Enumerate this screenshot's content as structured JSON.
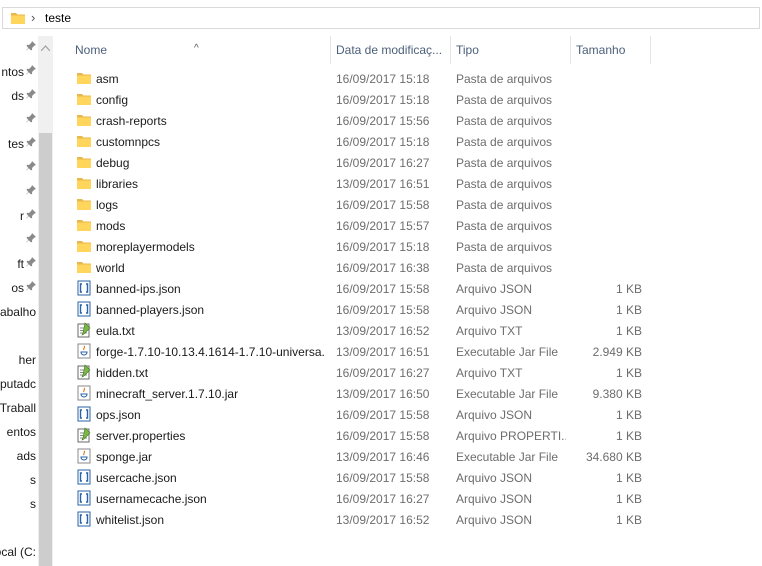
{
  "address": {
    "path": "teste"
  },
  "columns": {
    "name": "Nome",
    "date": "Data de modificaç...",
    "type": "Tipo",
    "size": "Tamanho"
  },
  "nav_items": [
    {
      "label": "",
      "pinned": true
    },
    {
      "label": "ntos",
      "pinned": true
    },
    {
      "label": "ds",
      "pinned": true
    },
    {
      "label": "",
      "pinned": true
    },
    {
      "label": "tes",
      "pinned": true
    },
    {
      "label": "",
      "pinned": true
    },
    {
      "label": "",
      "pinned": true
    },
    {
      "label": "r",
      "pinned": true
    },
    {
      "label": "",
      "pinned": true
    },
    {
      "label": "ft",
      "pinned": true
    },
    {
      "label": "os",
      "pinned": true
    },
    {
      "label": "abalho",
      "pinned": false
    },
    {
      "label": "",
      "pinned": false
    },
    {
      "label": "her",
      "pinned": false
    },
    {
      "label": "putadc",
      "pinned": false
    },
    {
      "label": "Traball",
      "pinned": false
    },
    {
      "label": "entos",
      "pinned": false
    },
    {
      "label": "ads",
      "pinned": false
    },
    {
      "label": "s",
      "pinned": false
    },
    {
      "label": "s",
      "pinned": false
    },
    {
      "label": "",
      "pinned": false
    },
    {
      "label": "ocal (C:",
      "pinned": false
    }
  ],
  "files": [
    {
      "name": "asm",
      "date": "16/09/2017 15:18",
      "type": "Pasta de arquivos",
      "size": "",
      "icon": "folder-icon"
    },
    {
      "name": "config",
      "date": "16/09/2017 15:18",
      "type": "Pasta de arquivos",
      "size": "",
      "icon": "folder-icon"
    },
    {
      "name": "crash-reports",
      "date": "16/09/2017 15:56",
      "type": "Pasta de arquivos",
      "size": "",
      "icon": "folder-icon"
    },
    {
      "name": "customnpcs",
      "date": "16/09/2017 15:18",
      "type": "Pasta de arquivos",
      "size": "",
      "icon": "folder-icon"
    },
    {
      "name": "debug",
      "date": "16/09/2017 16:27",
      "type": "Pasta de arquivos",
      "size": "",
      "icon": "folder-icon"
    },
    {
      "name": "libraries",
      "date": "13/09/2017 16:51",
      "type": "Pasta de arquivos",
      "size": "",
      "icon": "folder-icon"
    },
    {
      "name": "logs",
      "date": "16/09/2017 15:58",
      "type": "Pasta de arquivos",
      "size": "",
      "icon": "folder-icon"
    },
    {
      "name": "mods",
      "date": "16/09/2017 15:57",
      "type": "Pasta de arquivos",
      "size": "",
      "icon": "folder-icon"
    },
    {
      "name": "moreplayermodels",
      "date": "16/09/2017 15:18",
      "type": "Pasta de arquivos",
      "size": "",
      "icon": "folder-icon"
    },
    {
      "name": "world",
      "date": "16/09/2017 16:38",
      "type": "Pasta de arquivos",
      "size": "",
      "icon": "folder-icon"
    },
    {
      "name": "banned-ips.json",
      "date": "16/09/2017 15:58",
      "type": "Arquivo JSON",
      "size": "1 KB",
      "icon": "json-file-icon"
    },
    {
      "name": "banned-players.json",
      "date": "16/09/2017 15:58",
      "type": "Arquivo JSON",
      "size": "1 KB",
      "icon": "json-file-icon"
    },
    {
      "name": "eula.txt",
      "date": "13/09/2017 16:52",
      "type": "Arquivo TXT",
      "size": "1 KB",
      "icon": "text-file-icon"
    },
    {
      "name": "forge-1.7.10-10.13.4.1614-1.7.10-universa...",
      "date": "13/09/2017 16:51",
      "type": "Executable Jar File",
      "size": "2.949 KB",
      "icon": "jar-file-icon"
    },
    {
      "name": "hidden.txt",
      "date": "16/09/2017 16:27",
      "type": "Arquivo TXT",
      "size": "1 KB",
      "icon": "text-file-icon"
    },
    {
      "name": "minecraft_server.1.7.10.jar",
      "date": "13/09/2017 16:50",
      "type": "Executable Jar File",
      "size": "9.380 KB",
      "icon": "jar-file-icon"
    },
    {
      "name": "ops.json",
      "date": "16/09/2017 15:58",
      "type": "Arquivo JSON",
      "size": "1 KB",
      "icon": "json-file-icon"
    },
    {
      "name": "server.properties",
      "date": "16/09/2017 15:58",
      "type": "Arquivo PROPERTI...",
      "size": "1 KB",
      "icon": "text-file-icon"
    },
    {
      "name": "sponge.jar",
      "date": "13/09/2017 16:46",
      "type": "Executable Jar File",
      "size": "34.680 KB",
      "icon": "jar-file-icon"
    },
    {
      "name": "usercache.json",
      "date": "16/09/2017 15:58",
      "type": "Arquivo JSON",
      "size": "1 KB",
      "icon": "json-file-icon"
    },
    {
      "name": "usernamecache.json",
      "date": "16/09/2017 16:27",
      "type": "Arquivo JSON",
      "size": "1 KB",
      "icon": "json-file-icon"
    },
    {
      "name": "whitelist.json",
      "date": "13/09/2017 16:52",
      "type": "Arquivo JSON",
      "size": "1 KB",
      "icon": "json-file-icon"
    }
  ]
}
